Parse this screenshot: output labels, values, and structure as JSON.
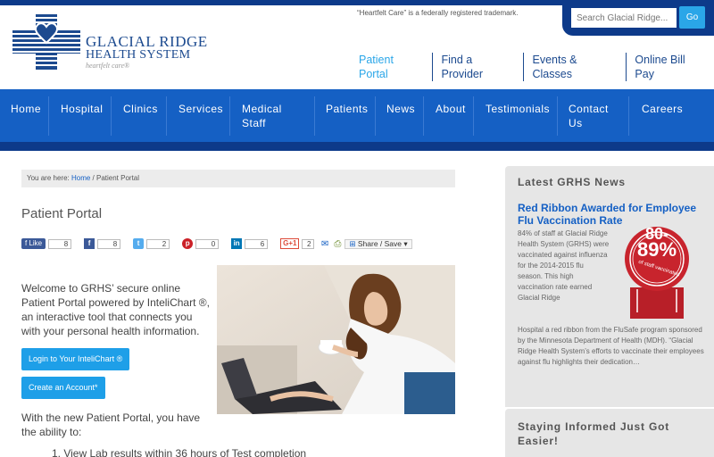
{
  "header": {
    "trademark": "“Heartfelt Care” is a federally registered trademark.",
    "brand_name": "GLACIAL RIDGE",
    "brand_sub": "HEALTH SYSTEM",
    "brand_tag": "heartfelt care®",
    "search_placeholder": "Search Glacial Ridge...",
    "search_button": "Go",
    "util_nav": [
      "Patient Portal",
      "Find a Provider",
      "Events & Classes",
      "Online Bill Pay"
    ]
  },
  "mainnav": {
    "home": "Home",
    "hospital": "Hospital",
    "clinics": "Clinics",
    "services": "Services",
    "medical_1": "Medical",
    "medical_2": "Staff",
    "patients": "Patients",
    "news": "News",
    "about": "About",
    "testimonials": "Testimonials",
    "contact_1": "Contact",
    "contact_2": "Us",
    "careers": "Careers"
  },
  "breadcrumb": {
    "prefix": "You are here: ",
    "home": "Home",
    "sep": " / ",
    "current": "Patient Portal"
  },
  "page_title": "Patient Portal",
  "social": {
    "fb_like": "Like",
    "fb_like_count": "8",
    "fb_share_count": "8",
    "twitter_count": "2",
    "pinterest_count": "0",
    "linkedin_count": "6",
    "gplus_label": "G+1",
    "gplus_count": "2",
    "share_save": "Share / Save"
  },
  "content": {
    "intro": "Welcome to GRHS’ secure online Patient Portal powered by InteliChart ®, an interactive tool that connects you with your personal health information.",
    "login_button": "Login to Your InteliChart ®",
    "create_button": "Create an Account*",
    "new_portal": "With the new Patient Portal, you have the ability to:",
    "list_item_1": "1.  View Lab results within 36 hours of Test completion"
  },
  "sidebar": {
    "heading": "Latest GRHS News",
    "news_title": "Red Ribbon Awarded for Employee Flu Vaccination Rate",
    "news_body_left": "84% of staff at Glacial Ridge Health System (GRHS) were vaccinated against influenza for the 2014-2015 flu season. This high vaccination rate earned Glacial Ridge",
    "news_body_full": "Hospital a red ribbon from the FluSafe program sponsored by the Minnesota Department of Health (MDH). “Glacial Ridge Health System’s efforts to vaccinate their employees against flu highlights their dedication…",
    "ribbon_top": "80-",
    "ribbon_pct": "89%",
    "ribbon_sub": "of staff vaccinated",
    "heading2": "Staying Informed Just Got Easier!"
  },
  "colors": {
    "nav_blue": "#1560c4",
    "dark_blue": "#0d3a8a",
    "button_blue": "#1e9fe8",
    "ribbon_red": "#c8242d"
  }
}
